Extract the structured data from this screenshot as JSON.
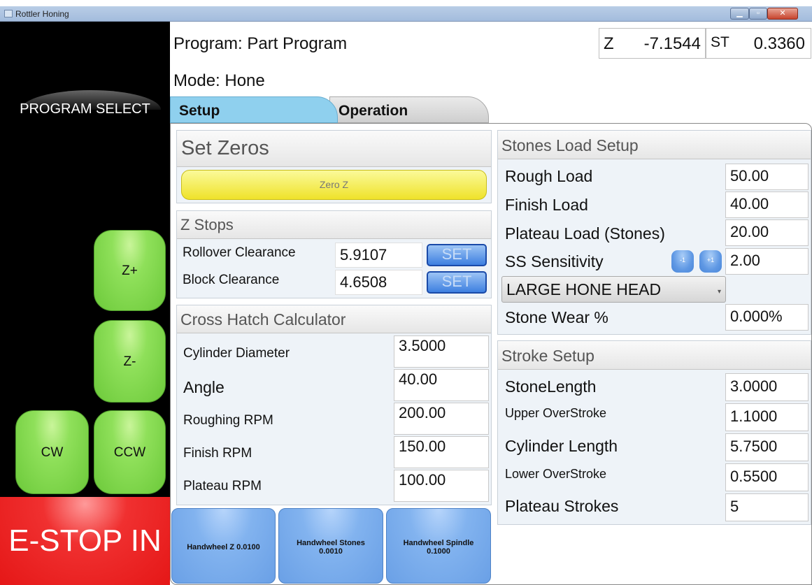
{
  "window": {
    "title": "Rottler Honing"
  },
  "header": {
    "program_label": "Program: Part Program",
    "mode_label": "Mode: Hone",
    "z_label": "Z",
    "z_value": "-7.1544",
    "st_label": "ST",
    "st_value": "0.3360"
  },
  "left": {
    "program_select": "PROGRAM SELECT",
    "z_plus": "Z+",
    "z_minus": "Z-",
    "cw": "CW",
    "ccw": "CCW",
    "estop": "E-STOP IN"
  },
  "tabs": [
    {
      "label": "Setup",
      "active": true
    },
    {
      "label": "Operation",
      "active": false
    }
  ],
  "set_zeros": {
    "title": "Set Zeros",
    "zero_z": "Zero Z"
  },
  "z_stops": {
    "title": "Z Stops",
    "rows": [
      {
        "label": "Rollover Clearance",
        "value": "5.9107",
        "button": "SET"
      },
      {
        "label": "Block Clearance",
        "value": "4.6508",
        "button": "SET"
      }
    ]
  },
  "cross_hatch": {
    "title": "Cross Hatch Calculator",
    "rows": [
      {
        "label": "Cylinder Diameter",
        "value": "3.5000"
      },
      {
        "label": "Angle",
        "value": "40.00"
      },
      {
        "label": "Roughing RPM",
        "value": "200.00"
      },
      {
        "label": "Finish RPM",
        "value": "150.00"
      },
      {
        "label": "Plateau RPM",
        "value": "100.00"
      }
    ]
  },
  "handwheels": [
    {
      "label": "Handwheel Z 0.0100"
    },
    {
      "label": "Handwheel Stones 0.0010"
    },
    {
      "label": "Handwheel Spindle 0.1000"
    }
  ],
  "stones": {
    "title": "Stones Load Setup",
    "rough_label": "Rough Load",
    "rough_value": "50.00",
    "finish_label": "Finish Load",
    "finish_value": "40.00",
    "plateau_label": "Plateau Load (Stones)",
    "plateau_value": "20.00",
    "ss_label": "SS Sensitivity",
    "ss_minus": "-1",
    "ss_plus": "+1",
    "ss_value": "2.00",
    "head_select": "LARGE HONE HEAD",
    "wear_label": "Stone Wear %",
    "wear_value": "0.000%"
  },
  "stroke": {
    "title": "Stroke Setup",
    "rows": [
      {
        "label": "StoneLength",
        "value": "3.0000"
      },
      {
        "label": "Upper OverStroke",
        "value": "1.1000"
      },
      {
        "label": "Cylinder Length",
        "value": "5.7500"
      },
      {
        "label": "Lower OverStroke",
        "value": "0.5500"
      },
      {
        "label": "Plateau Strokes",
        "value": "5"
      }
    ]
  },
  "colors": {
    "accent_green": "#6cc93a",
    "estop_red": "#e51717",
    "tab_active": "#8fd0ee",
    "set_blue": "#3d7fe0"
  }
}
